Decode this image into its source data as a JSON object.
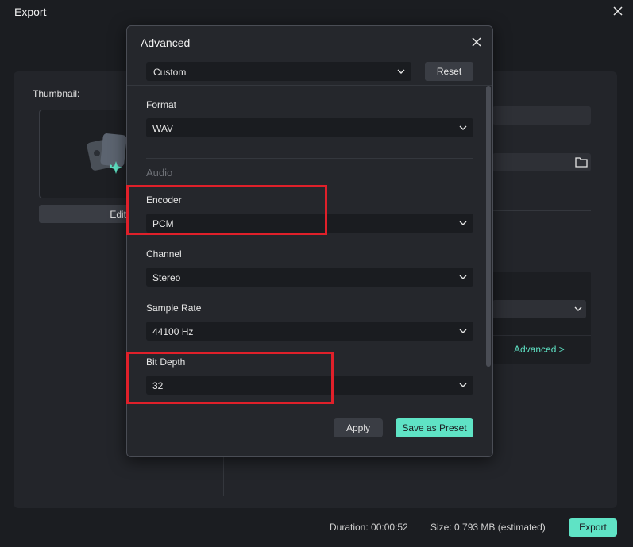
{
  "window": {
    "title": "Export"
  },
  "thumbnail": {
    "label": "Thumbnail:",
    "edit_label": "Edit"
  },
  "footer": {
    "duration_label": "Duration:",
    "duration_value": "00:00:52",
    "size_label": "Size:",
    "size_value": "0.793 MB (estimated)",
    "export_label": "Export"
  },
  "advanced_link": "Advanced >",
  "dialog": {
    "title": "Advanced",
    "preset": "Custom",
    "reset_label": "Reset",
    "format": {
      "label": "Format",
      "value": "WAV"
    },
    "audio_section": "Audio",
    "encoder": {
      "label": "Encoder",
      "value": "PCM"
    },
    "channel": {
      "label": "Channel",
      "value": "Stereo"
    },
    "sample_rate": {
      "label": "Sample Rate",
      "value": "44100 Hz"
    },
    "bit_depth": {
      "label": "Bit Depth",
      "value": "32"
    },
    "apply_label": "Apply",
    "save_preset_label": "Save as Preset"
  },
  "colors": {
    "accent": "#5fe3c5",
    "highlight": "#e0202a",
    "background": "#1b1d21"
  }
}
